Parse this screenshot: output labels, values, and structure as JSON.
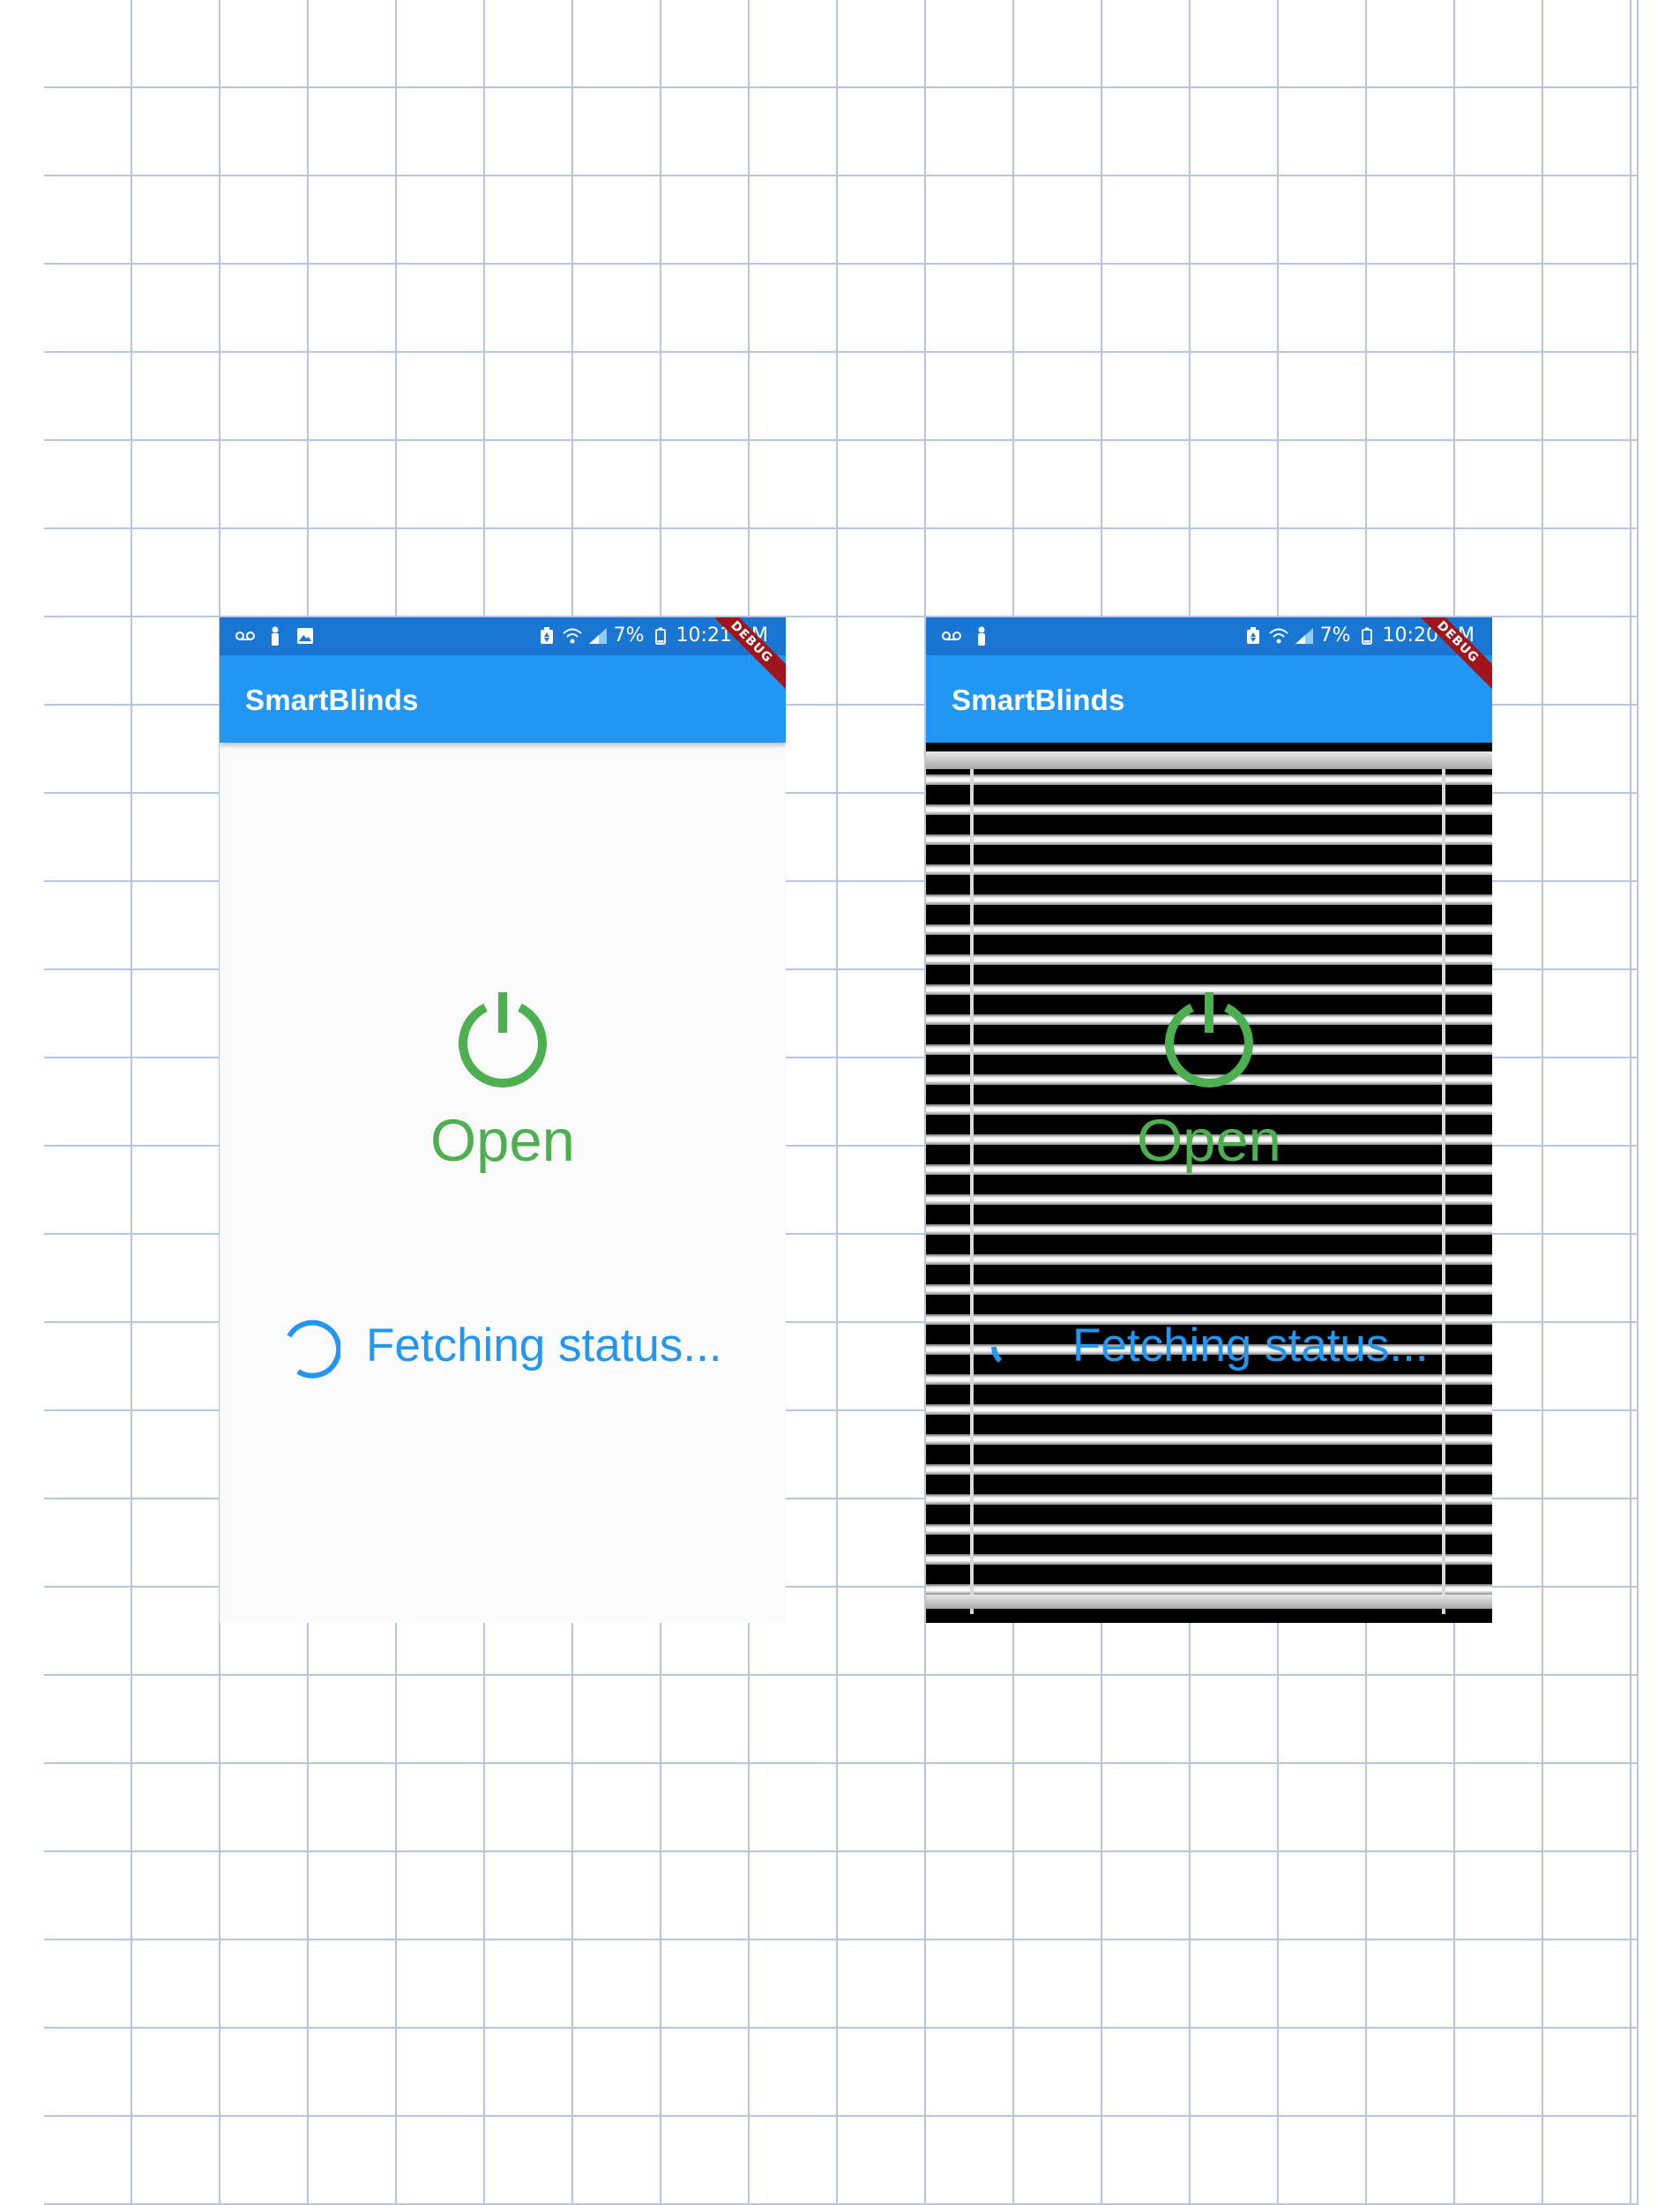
{
  "phones": [
    {
      "status_bar": {
        "battery": "7%",
        "time": "10:21 AM"
      },
      "debug_banner": "DEBUG",
      "app_title": "SmartBlinds",
      "state_label": "Open",
      "fetch_text": "Fetching status...",
      "background": "plain"
    },
    {
      "status_bar": {
        "battery": "7%",
        "time": "10:20 AM"
      },
      "debug_banner": "DEBUG",
      "app_title": "SmartBlinds",
      "state_label": "Open",
      "fetch_text": "Fetching status...",
      "background": "window-blinds"
    }
  ],
  "colors": {
    "status_bar": "#1976d2",
    "app_bar": "#2196f3",
    "open_green": "#4caf50",
    "fetch_blue": "#2196f3",
    "debug_red": "#a0151b",
    "grid_line": "#b7c6dc"
  },
  "icons": {
    "status_left": [
      "voicemail-icon",
      "person-icon",
      "image-icon"
    ],
    "status_right": [
      "battery-saver-icon",
      "wifi-icon",
      "signal-icon",
      "battery-icon"
    ],
    "main": "power-icon",
    "loading": "spinner-icon"
  }
}
